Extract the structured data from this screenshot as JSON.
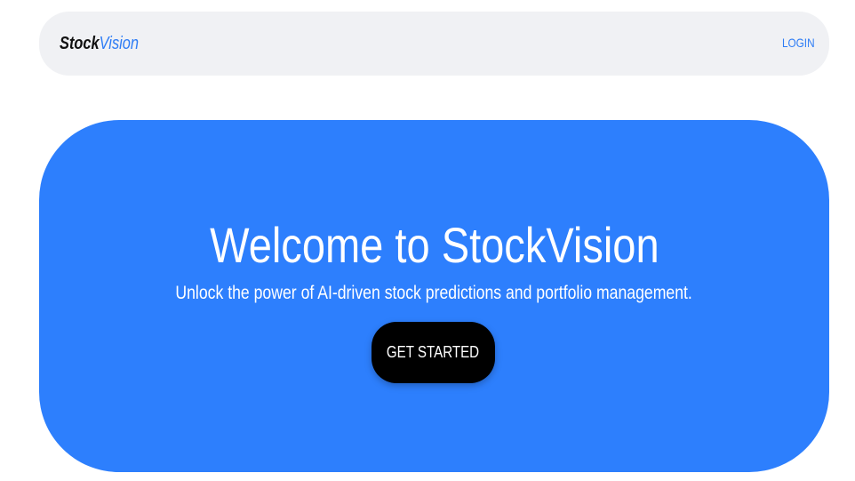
{
  "navbar": {
    "brand_primary": "Stock",
    "brand_accent": "Vision",
    "login_label": "LOGIN"
  },
  "hero": {
    "title": "Welcome to StockVision",
    "subtitle": "Unlock the power of AI-driven stock predictions and portfolio management.",
    "cta_label": "GET STARTED"
  },
  "colors": {
    "accent": "#2d7cf5",
    "hero_background": "#2d7ffd",
    "navbar_background": "#f0f1f4",
    "cta_background": "#000000"
  }
}
